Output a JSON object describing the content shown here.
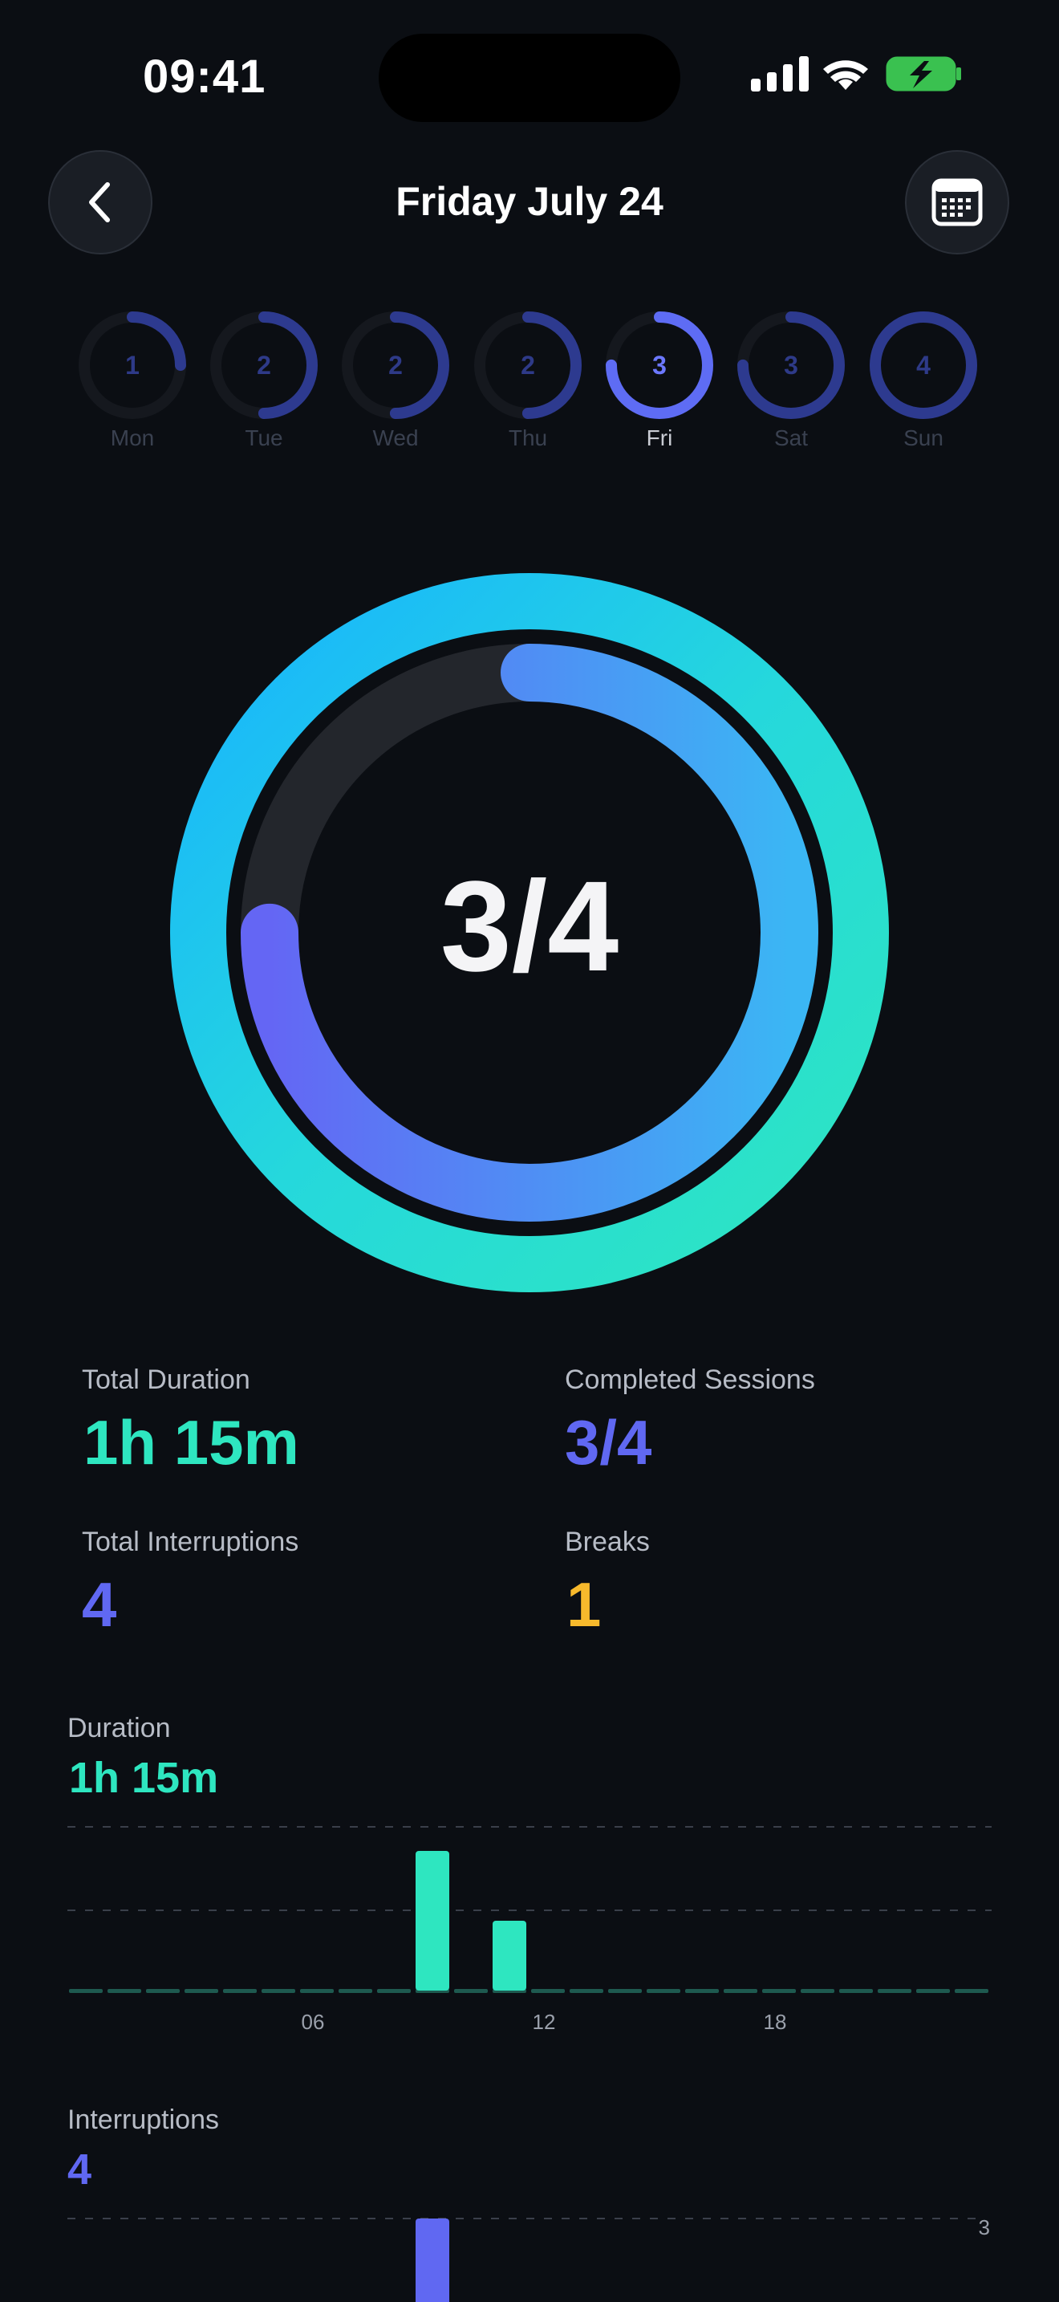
{
  "status_bar": {
    "time": "09:41"
  },
  "header": {
    "title": "Friday July 24"
  },
  "week": {
    "days": [
      {
        "label": "Mon",
        "count": "1",
        "progress": 0.25,
        "active": false
      },
      {
        "label": "Tue",
        "count": "2",
        "progress": 0.5,
        "active": false
      },
      {
        "label": "Wed",
        "count": "2",
        "progress": 0.5,
        "active": false
      },
      {
        "label": "Thu",
        "count": "2",
        "progress": 0.5,
        "active": false
      },
      {
        "label": "Fri",
        "count": "3",
        "progress": 0.75,
        "active": true
      },
      {
        "label": "Sat",
        "count": "3",
        "progress": 0.75,
        "active": false
      },
      {
        "label": "Sun",
        "count": "4",
        "progress": 1.0,
        "active": false
      }
    ]
  },
  "main_ring": {
    "center_text": "3/4",
    "inner_progress": 0.75,
    "outer_progress": 1.0
  },
  "stats": {
    "total_duration": {
      "label": "Total Duration",
      "value": "1h 15m"
    },
    "completed_sessions": {
      "label": "Completed Sessions",
      "value": "3/4"
    },
    "total_interruptions": {
      "label": "Total Interruptions",
      "value": "4"
    },
    "breaks": {
      "label": "Breaks",
      "value": "1"
    }
  },
  "duration_section": {
    "label": "Duration",
    "value": "1h 15m"
  },
  "interruptions_section": {
    "label": "Interruptions",
    "value": "4"
  },
  "chart_data": [
    {
      "type": "bar",
      "x_ticks": [
        "06",
        "12",
        "18"
      ],
      "x": [
        9,
        11
      ],
      "values": [
        1.0,
        0.5
      ],
      "bar_color": "#2ee6c0",
      "grid": true
    },
    {
      "type": "bar",
      "x_ticks": [],
      "y_ticks": [
        "3"
      ],
      "x": [
        9
      ],
      "values": [
        3
      ],
      "bar_color": "#6068f2",
      "grid": true
    }
  ],
  "colors": {
    "teal": "#2ee6c0",
    "indigo": "#6068f2",
    "amber": "#f7b92c",
    "background": "#0b0e13"
  }
}
